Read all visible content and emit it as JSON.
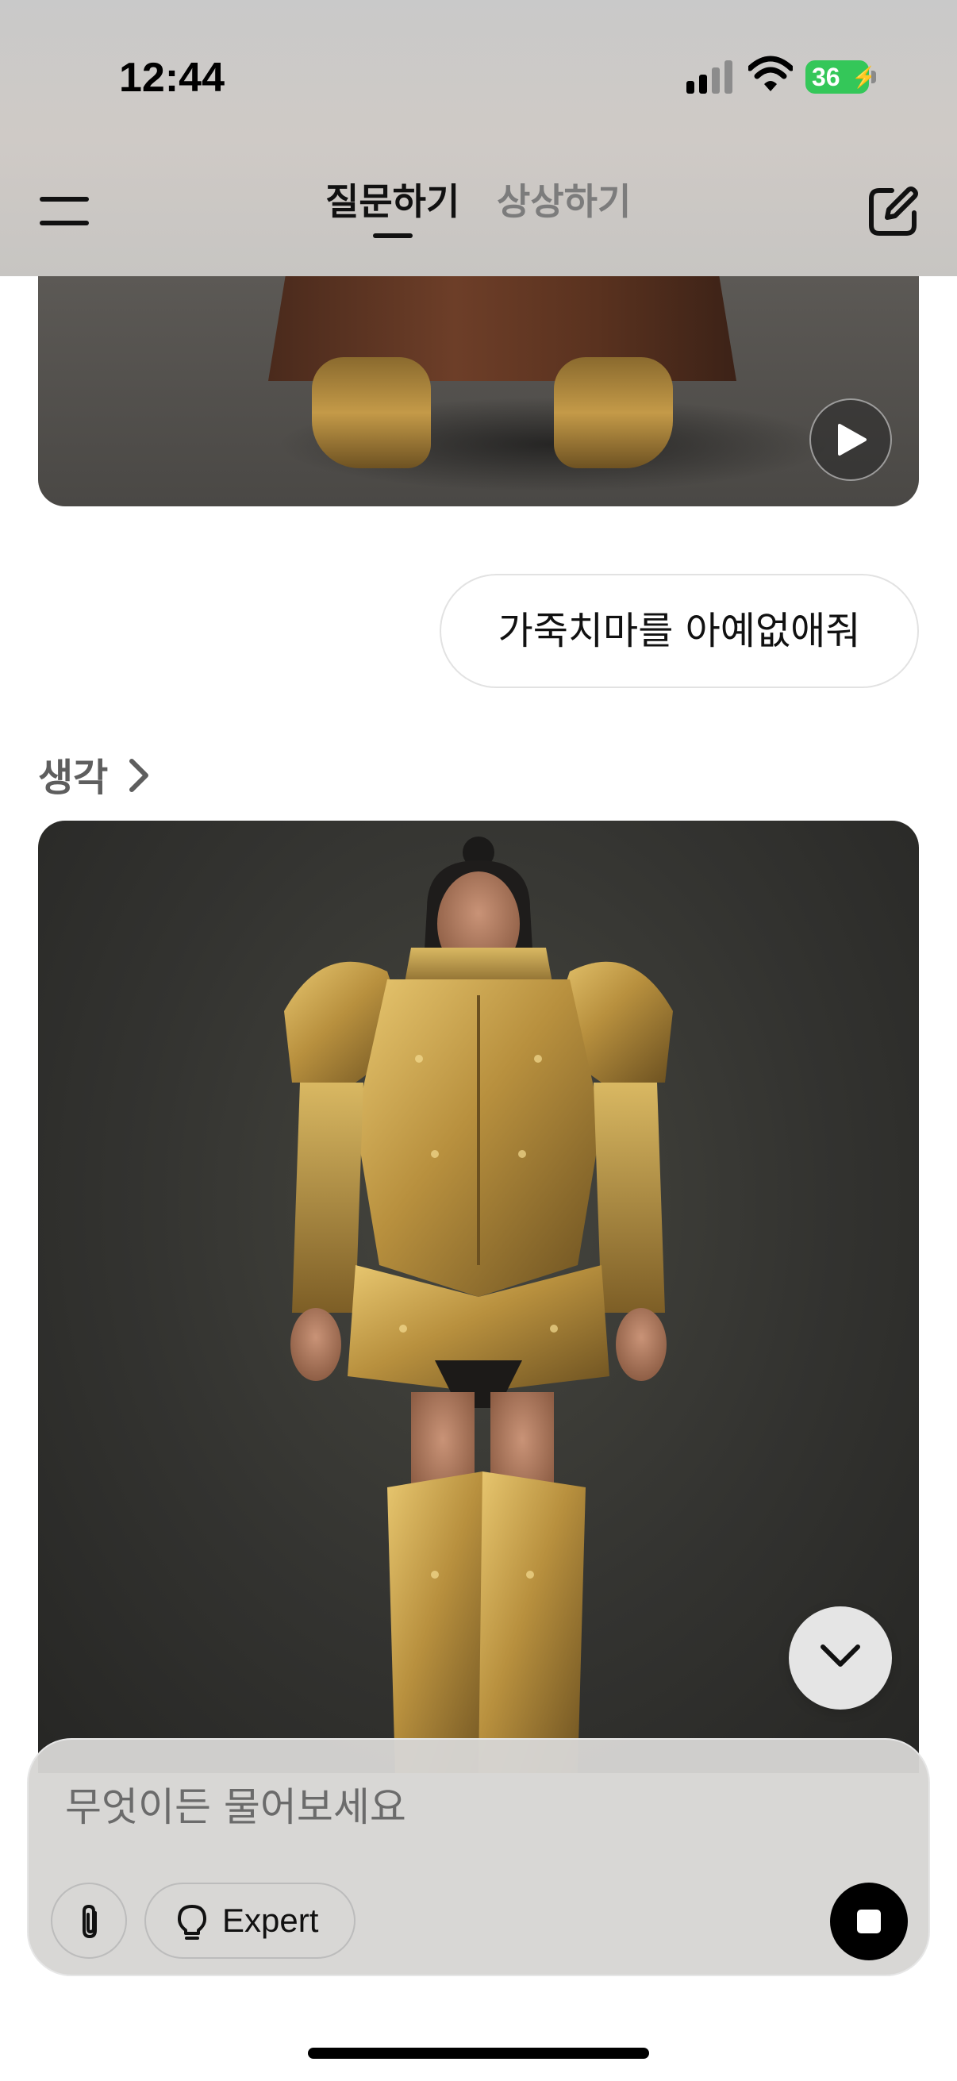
{
  "status_bar": {
    "time": "12:44",
    "battery_level": "36",
    "battery_color": "#34c759"
  },
  "nav": {
    "tabs": [
      {
        "label": "질문하기",
        "active": true
      },
      {
        "label": "상상하기",
        "active": false
      }
    ],
    "left_icon": "menu-icon",
    "right_icon": "compose-icon"
  },
  "chat": {
    "user_message": "가죽치마를 아예없애줘",
    "thinking_label": "생각",
    "previous_image_control": "play-icon"
  },
  "composer": {
    "placeholder": "무엇이든 물어보세요",
    "expert_label": "Expert",
    "attach_icon": "paperclip-icon",
    "mode_icon": "lightbulb-icon",
    "send_icon": "stop-icon"
  }
}
